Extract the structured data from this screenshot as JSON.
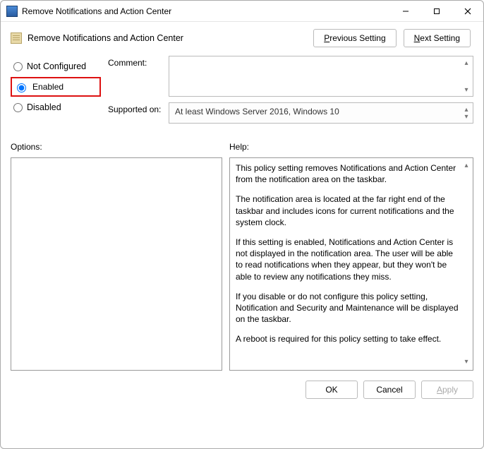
{
  "window": {
    "title": "Remove Notifications and Action Center",
    "subtitle": "Remove Notifications and Action Center"
  },
  "nav": {
    "previous": "Previous Setting",
    "previous_ul": "P",
    "next": "Next Setting",
    "next_ul": "N"
  },
  "radios": {
    "not_configured": "Not Configured",
    "not_configured_ul": "C",
    "enabled": "Enabled",
    "enabled_ul": "E",
    "disabled": "Disabled",
    "disabled_ul": "D",
    "selected": "enabled"
  },
  "labels": {
    "comment": "Comment:",
    "supported_on": "Supported on:",
    "options": "Options:",
    "help": "Help:"
  },
  "supported_on": "At least Windows Server 2016, Windows 10",
  "help": {
    "p1": "This policy setting removes Notifications and Action Center from the notification area on the taskbar.",
    "p2": "The notification area is located at the far right end of the taskbar and includes icons for current notifications and the system clock.",
    "p3": "If this setting is enabled, Notifications and Action Center is not displayed in the notification area. The user will be able to read notifications when they appear, but they won't be able to review any notifications they miss.",
    "p4": "If you disable or do not configure this policy setting, Notification and Security and Maintenance will be displayed on the taskbar.",
    "p5": "A reboot is required for this policy setting to take effect."
  },
  "footer": {
    "ok": "OK",
    "cancel": "Cancel",
    "apply": "Apply",
    "apply_ul": "A"
  }
}
